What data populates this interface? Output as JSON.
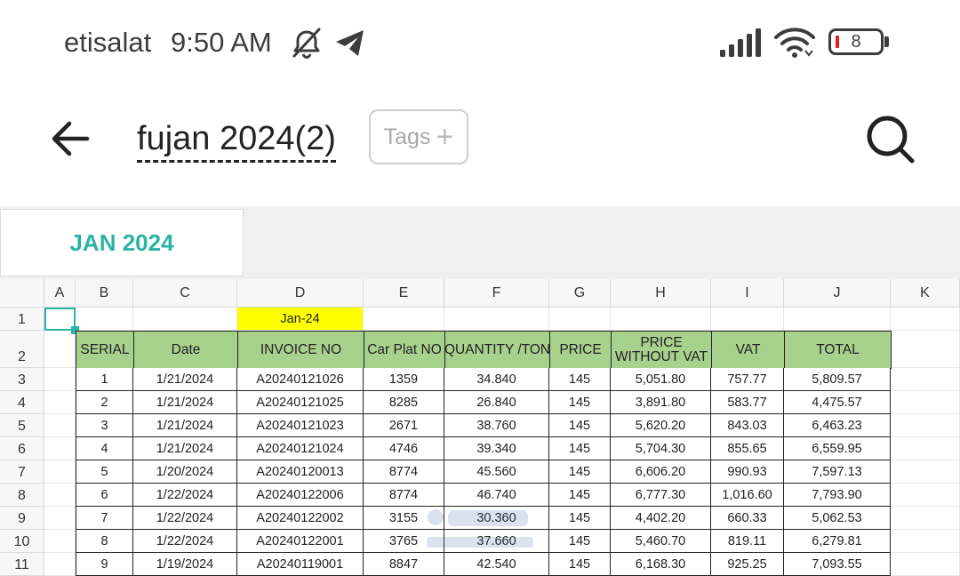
{
  "status_bar": {
    "carrier": "etisalat",
    "time": "9:50 AM",
    "battery": "8"
  },
  "toolbar": {
    "title": "fujan 2024(2)",
    "tags_label": "Tags",
    "tags_plus": "+"
  },
  "sheet_tabs": [
    {
      "label": "JAN 2024"
    }
  ],
  "spreadsheet": {
    "columns": [
      "A",
      "B",
      "C",
      "D",
      "E",
      "F",
      "G",
      "H",
      "I",
      "J",
      "K"
    ],
    "row_numbers": [
      "1",
      "2",
      "3",
      "4",
      "5",
      "6",
      "7",
      "8",
      "9",
      "10",
      "11"
    ],
    "date_label": "Jan-24",
    "headers": [
      "SERIAL",
      "Date",
      "INVOICE NO",
      "Car Plat NO",
      "QUANTITY /TON",
      "PRICE",
      "PRICE\nWITHOUT VAT",
      "VAT",
      "TOTAL"
    ],
    "rows": [
      [
        "1",
        "1/21/2024",
        "A20240121026",
        "1359",
        "34.840",
        "145",
        "5,051.80",
        "757.77",
        "5,809.57"
      ],
      [
        "2",
        "1/21/2024",
        "A20240121025",
        "8285",
        "26.840",
        "145",
        "3,891.80",
        "583.77",
        "4,475.57"
      ],
      [
        "3",
        "1/21/2024",
        "A20240121023",
        "2671",
        "38.760",
        "145",
        "5,620.20",
        "843.03",
        "6,463.23"
      ],
      [
        "4",
        "1/21/2024",
        "A20240121024",
        "4746",
        "39.340",
        "145",
        "5,704.30",
        "855.65",
        "6,559.95"
      ],
      [
        "5",
        "1/20/2024",
        "A20240120013",
        "8774",
        "45.560",
        "145",
        "6,606.20",
        "990.93",
        "7,597.13"
      ],
      [
        "6",
        "1/22/2024",
        "A20240122006",
        "8774",
        "46.740",
        "145",
        "6,777.30",
        "1,016.60",
        "7,793.90"
      ],
      [
        "7",
        "1/22/2024",
        "A20240122002",
        "3155",
        "30.360",
        "145",
        "4,402.20",
        "660.33",
        "5,062.53"
      ],
      [
        "8",
        "1/22/2024",
        "A20240122001",
        "3765",
        "37.660",
        "145",
        "5,460.70",
        "819.11",
        "6,279.81"
      ],
      [
        "9",
        "1/19/2024",
        "A20240119001",
        "8847",
        "42.540",
        "145",
        "6,168.30",
        "925.25",
        "7,093.55"
      ]
    ]
  },
  "colors": {
    "accent": "#2bb3a6",
    "header_green": "#a9d18e",
    "highlight_yellow": "#ffff00"
  }
}
